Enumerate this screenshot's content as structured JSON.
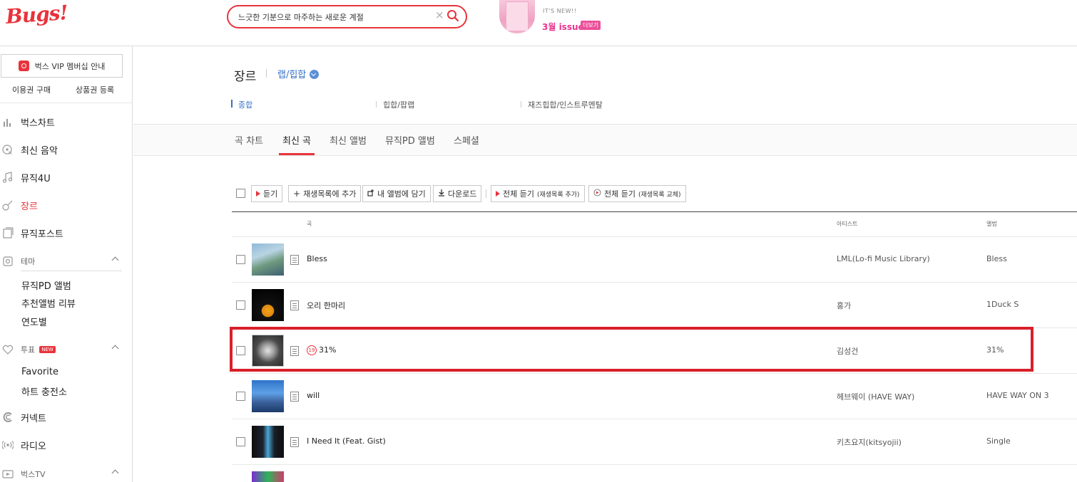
{
  "header": {
    "logo": "Bugs!",
    "search_value": "느긋한 기분으로 마주하는 새로운 계절",
    "promo": {
      "small_text": "IT'S NEW!!",
      "issue": "3월 issue",
      "more": "더보기"
    }
  },
  "sidebar": {
    "vip_label": "벅스 VIP 멤버십 안내",
    "buy_ticket": "이용권 구매",
    "gift_register": "상품권 등록",
    "nav": [
      {
        "label": "벅스차트",
        "icon": "chart-bars-icon"
      },
      {
        "label": "최신 음악",
        "icon": "new-music-icon"
      },
      {
        "label": "뮤직4U",
        "icon": "music-note-icon"
      },
      {
        "label": "장르",
        "icon": "guitar-icon"
      },
      {
        "label": "뮤직포스트",
        "icon": "post-icon"
      }
    ],
    "theme": {
      "label": "테마",
      "items": [
        "뮤직PD 앨범",
        "추천앨범 리뷰",
        "연도별"
      ]
    },
    "vote": {
      "label": "투표",
      "badge": "NEW",
      "items": [
        "Favorite",
        "하트 충전소"
      ]
    },
    "connect": "커넥트",
    "radio": "라디오",
    "bugstv": "벅스TV"
  },
  "genre": {
    "title": "장르",
    "selected": "랩/힙합",
    "subgenres": [
      "종합",
      "힙합/팝랩",
      "재즈힙합/인스트루멘탈"
    ]
  },
  "tabs": [
    "곡 차트",
    "최신 곡",
    "최신 앨범",
    "뮤직PD 앨범",
    "스페셜"
  ],
  "toolbar": {
    "listen": "듣기",
    "add_playlist": "재생목록에 추가",
    "add_album": "내 앨범에 담기",
    "download": "다운로드",
    "play_all_add": "전체 듣기",
    "play_all_add_sub": "(재생목록 추가)",
    "play_all_replace": "전체 듣기",
    "play_all_replace_sub": "(재생목록 교체)"
  },
  "table": {
    "headers": {
      "song": "곡",
      "artist": "아티스트",
      "album": "앨범"
    },
    "rows": [
      {
        "title": "Bless",
        "artist": "LML(Lo-fi Music Library)",
        "album": "Bless",
        "adult": false
      },
      {
        "title": "오리 한마리",
        "artist": "홍가",
        "album": "1Duck S",
        "adult": false
      },
      {
        "title": "31%",
        "artist": "김성건",
        "album": "31%",
        "adult": true,
        "adult_label": "19"
      },
      {
        "title": "will",
        "artist": "헤브웨이 (HAVE WAY)",
        "album": "HAVE WAY ON 3",
        "adult": false
      },
      {
        "title": "I Need It (Feat. Gist)",
        "artist": "키츠요지(kitsyojii)",
        "album": "Single",
        "adult": false
      }
    ]
  },
  "colors": {
    "brand": "#e8333c",
    "link_blue": "#3770c4",
    "highlight": "#d9202b"
  }
}
